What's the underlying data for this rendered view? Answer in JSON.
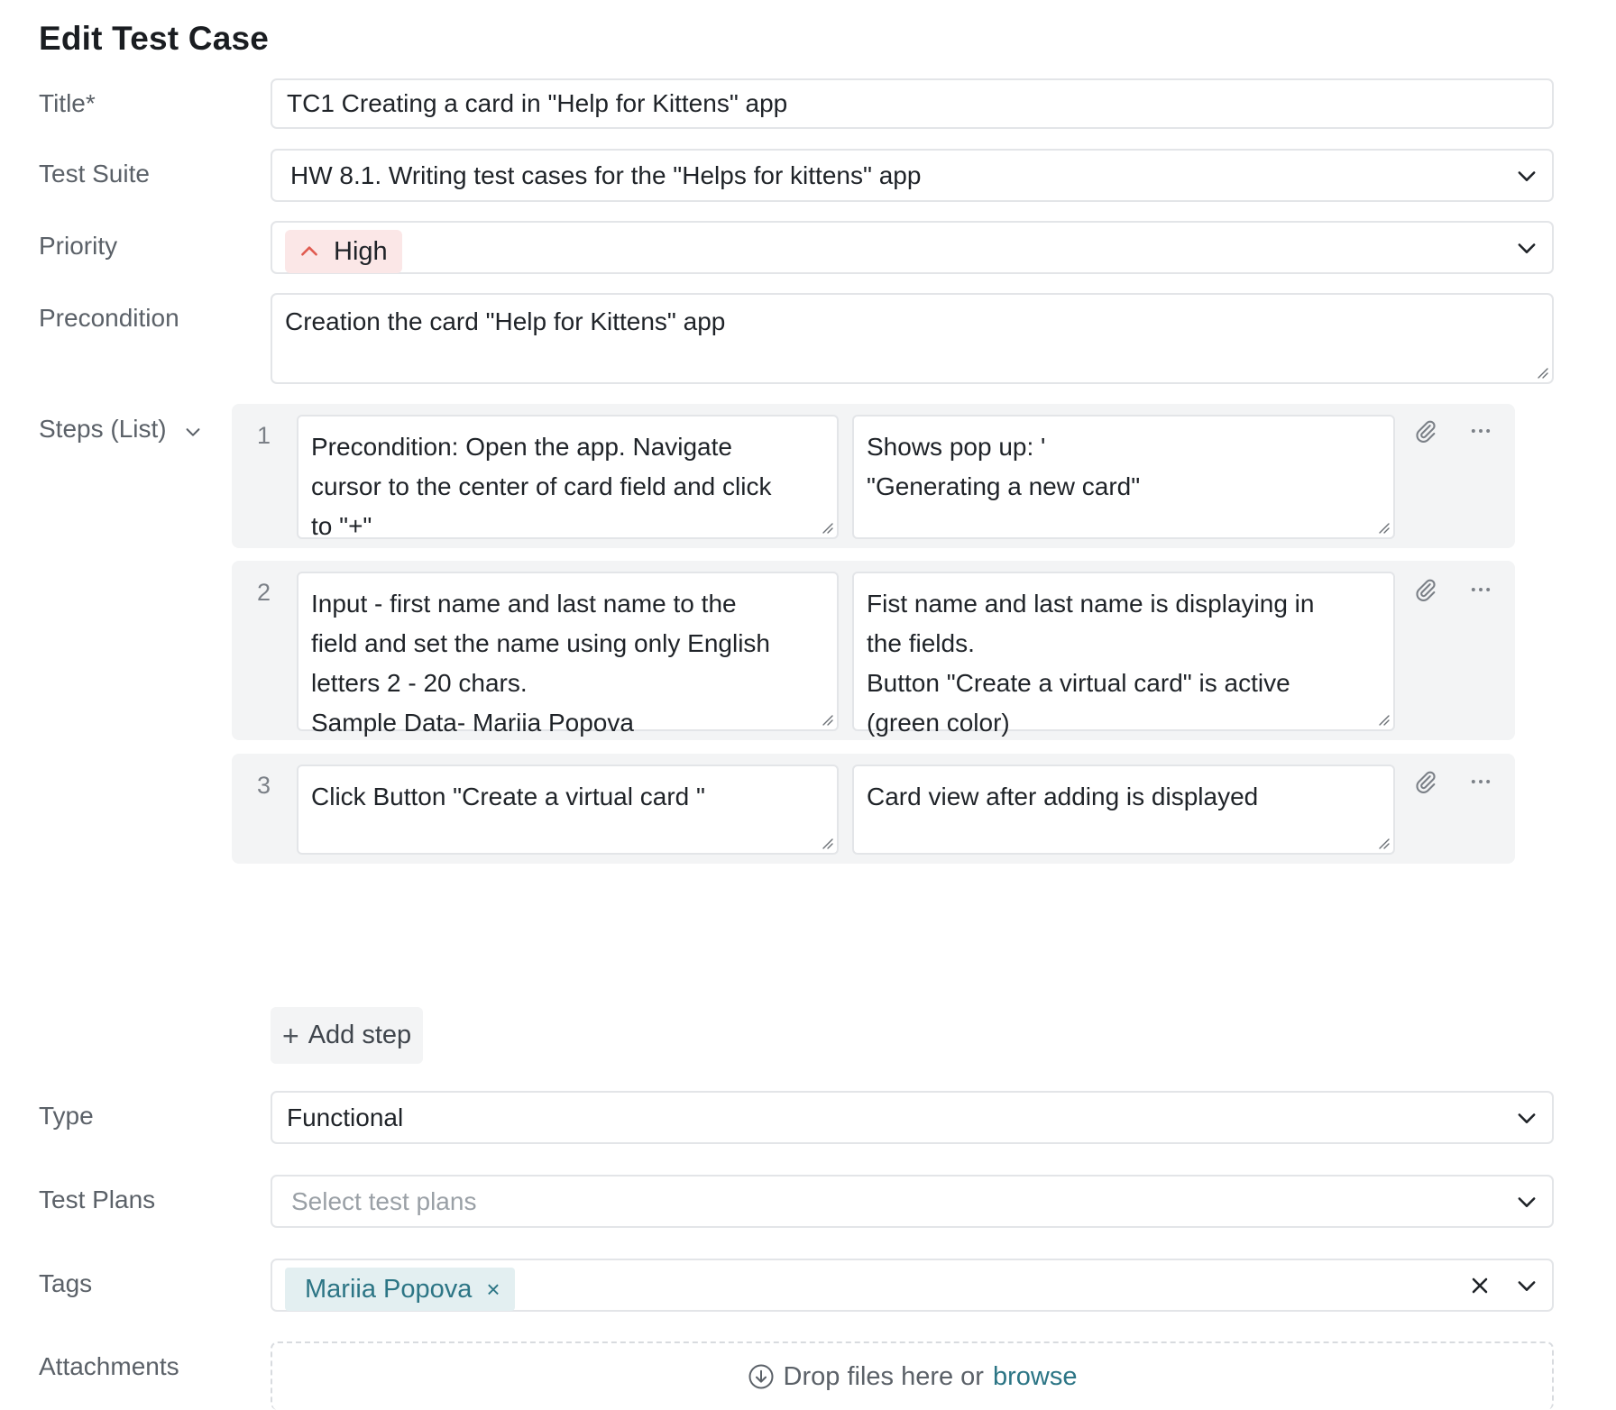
{
  "page": {
    "title": "Edit Test Case"
  },
  "form": {
    "title": {
      "label": "Title*",
      "value": "TC1 Creating a card in \"Help for Kittens\" app"
    },
    "test_suite": {
      "label": "Test Suite",
      "value": "HW 8.1. Writing test cases for the \"Helps for kittens\" app"
    },
    "priority": {
      "label": "Priority",
      "value": "High",
      "color": "#e05a4f"
    },
    "precondition": {
      "label": "Precondition",
      "value": "Creation the card \"Help for Kittens\" app"
    },
    "steps": {
      "label": "Steps (List)",
      "items": [
        {
          "number": "1",
          "action": "Precondition: Open the app. Navigate\ncursor to the center of card field and click\nto \"+\"",
          "expected": "Shows pop up: '\n\"Generating a new card\""
        },
        {
          "number": "2",
          "action": "Input - first name and last name to the\nfield and set the name using only English\nletters 2 - 20 chars.\nSample Data- Mariia Popova",
          "expected": "Fist name and last name is displaying in\nthe fields.\nButton \"Create a virtual card\" is active\n(green color)"
        },
        {
          "number": "3",
          "action": "Click Button \"Create a virtual card \"",
          "expected": "Card view after adding is displayed"
        }
      ],
      "add_step_label": "Add step"
    },
    "type": {
      "label": "Type",
      "value": "Functional"
    },
    "test_plans": {
      "label": "Test Plans",
      "placeholder": "Select test plans"
    },
    "tags": {
      "label": "Tags",
      "items": [
        "Mariia Popova"
      ],
      "accent": "#2c7585"
    },
    "attachments": {
      "label": "Attachments",
      "drop_text": "Drop files here or",
      "browse_text": "browse"
    }
  },
  "icons": {
    "chevron": "chevron-down-icon",
    "priority_arrow": "chevron-up-icon",
    "attach": "paperclip-icon",
    "more": "more-horizontal-icon",
    "clear": "close-icon",
    "upload": "download-circle-icon"
  }
}
